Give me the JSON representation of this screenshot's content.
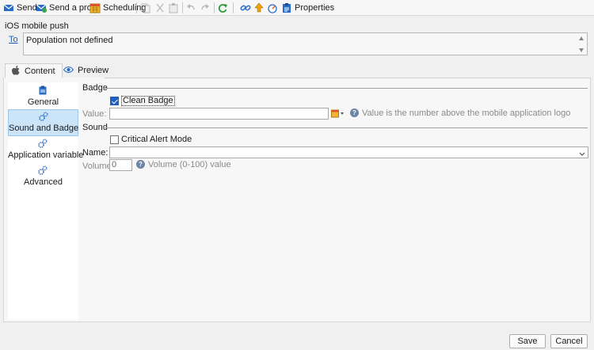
{
  "toolbar": {
    "send": "Send",
    "send_proof": "Send a proof",
    "scheduling": "Scheduling",
    "properties": "Properties"
  },
  "header": {
    "title": "iOS mobile push",
    "to_label": "To",
    "to_value": "Population not defined"
  },
  "tabs": [
    {
      "label": "Content",
      "icon": "apple-icon",
      "active": true
    },
    {
      "label": "Preview",
      "icon": "eye-icon",
      "active": false
    }
  ],
  "nav": [
    {
      "label": "General",
      "icon": "clipboard-icon",
      "active": false
    },
    {
      "label": "Sound and Badge",
      "icon": "gears-icon",
      "active": true
    },
    {
      "label": "Application variable",
      "icon": "gears-icon",
      "active": false
    },
    {
      "label": "Advanced",
      "icon": "gears-icon",
      "active": false
    }
  ],
  "badge": {
    "section": "Badge",
    "clean_badge_label": "Clean Badge",
    "clean_badge_checked": true,
    "value_label": "Value:",
    "value": "",
    "value_help": "Value is the number above the mobile application logo"
  },
  "sound": {
    "section": "Sound",
    "critical_label": "Critical Alert Mode",
    "critical_checked": false,
    "name_label": "Name:",
    "name_value": "",
    "volume_label": "Volume:",
    "volume_value": "0",
    "volume_help": "Volume (0-100) value"
  },
  "footer": {
    "save": "Save",
    "cancel": "Cancel"
  },
  "colors": {
    "accent": "#1f5fbf",
    "selected_nav": "#cce4f7",
    "link": "#1c5fbd"
  }
}
